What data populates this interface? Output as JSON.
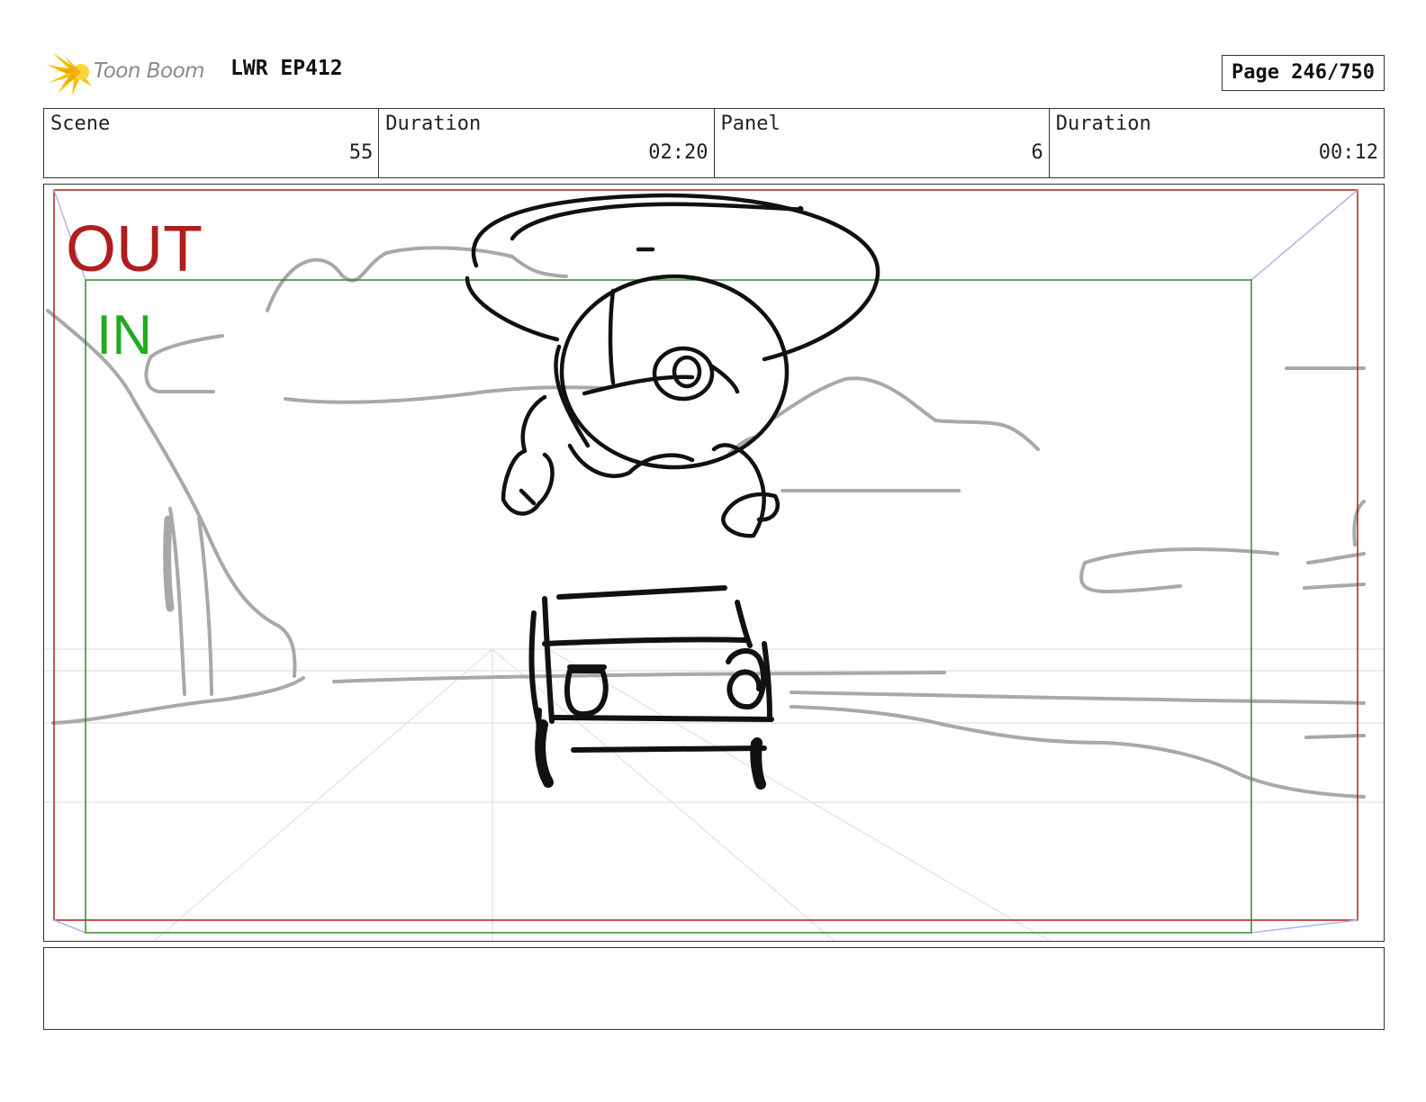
{
  "header": {
    "logo_text": "Toon Boom",
    "project_title": "LWR EP412",
    "page_label": "Page 246/750"
  },
  "info": {
    "scene_label": "Scene",
    "scene_value": "55",
    "scene_duration_label": "Duration",
    "scene_duration_value": "02:20",
    "panel_label": "Panel",
    "panel_value": "6",
    "panel_duration_label": "Duration",
    "panel_duration_value": "00:12"
  },
  "panel": {
    "out_label": "OUT",
    "in_label": "IN"
  },
  "colors": {
    "out_frame": "#b01e1e",
    "in_frame": "#2e8b2e",
    "in_text": "#22aa22",
    "sketch_bg": "#a8a8a8",
    "sketch_fg": "#111111",
    "logo_star": "#f5c000"
  },
  "caption": ""
}
